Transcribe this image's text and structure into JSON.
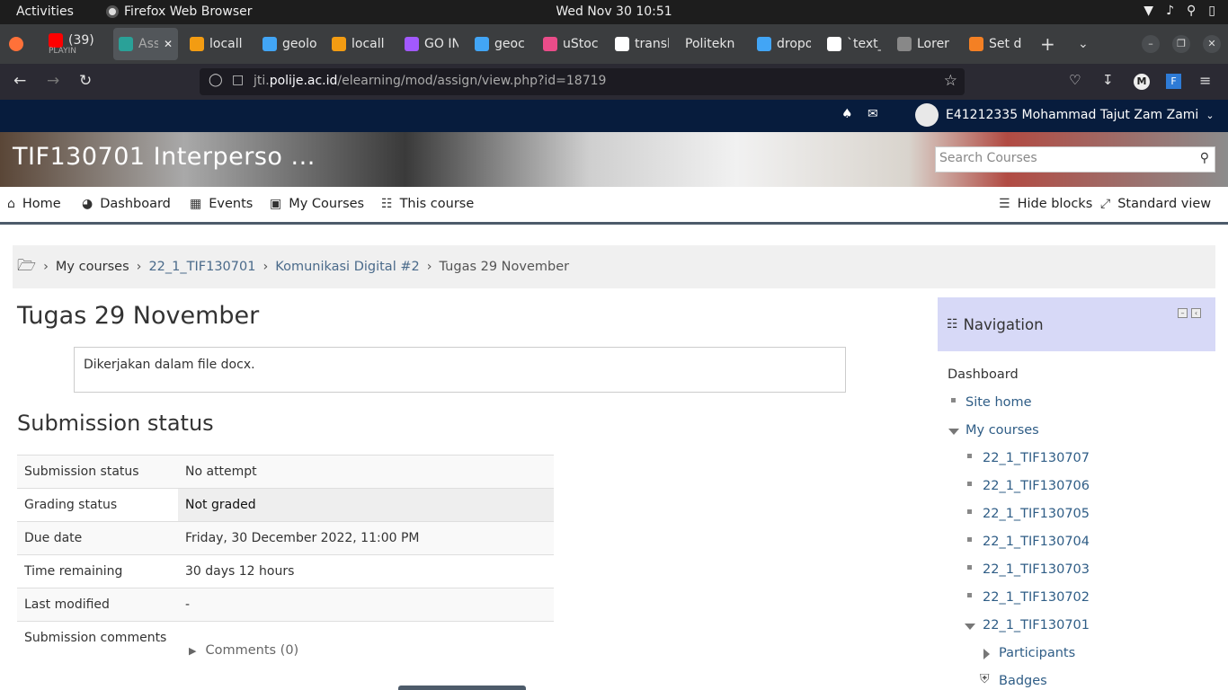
{
  "system": {
    "activities": "Activities",
    "app_name": "Firefox Web Browser",
    "clock": "Wed Nov 30  10:51"
  },
  "tabs": [
    {
      "title": "(39)",
      "subtitle": "PLAYIN",
      "icon": "youtube-icon",
      "color": "#ff0000"
    },
    {
      "title": "Ass",
      "icon": "moodle-icon",
      "color": "#2aa198",
      "active": true
    },
    {
      "title": "locall",
      "icon": "xampp-icon",
      "color": "#f39c12"
    },
    {
      "title": "geolo",
      "icon": "flutter-icon",
      "color": "#42a5f5"
    },
    {
      "title": "locall",
      "icon": "xampp-icon",
      "color": "#f39c12"
    },
    {
      "title": "GO IN",
      "icon": "figma-icon",
      "color": "#a259ff"
    },
    {
      "title": "geoc",
      "icon": "flutter-icon",
      "color": "#42a5f5"
    },
    {
      "title": "uStoc",
      "icon": "dribbble-icon",
      "color": "#ea4c89"
    },
    {
      "title": "transl",
      "icon": "google-icon",
      "color": "#ffffff"
    },
    {
      "title": "Politekn",
      "icon": "",
      "color": "#3b3d3f"
    },
    {
      "title": "dropo",
      "icon": "flutter-icon",
      "color": "#42a5f5"
    },
    {
      "title": "`text_",
      "icon": "github-icon",
      "color": "#ffffff"
    },
    {
      "title": "Lorer",
      "icon": "lorem-icon",
      "color": "#888888"
    },
    {
      "title": "Set d",
      "icon": "stackoverflow-icon",
      "color": "#f48024"
    }
  ],
  "browser": {
    "url_domain": "jti.",
    "url_domain_bold": "polije.ac.id",
    "url_path": "/elearning/mod/assign/view.php?id=18719"
  },
  "moodle": {
    "user_name": "E41212335 Mohammad Tajut Zam Zami",
    "course_title": "TIF130701 Interperso ...",
    "search_placeholder": "Search Courses",
    "menu": {
      "home": "Home",
      "dashboard": "Dashboard",
      "events": "Events",
      "my_courses": "My Courses",
      "this_course": "This course",
      "hide_blocks": "Hide blocks",
      "standard_view": "Standard view"
    },
    "breadcrumb": [
      "My courses",
      "22_1_TIF130701",
      "Komunikasi Digital #2",
      "Tugas 29 November"
    ]
  },
  "assignment": {
    "title": "Tugas 29 November",
    "intro": "Dikerjakan dalam file docx.",
    "status_heading": "Submission status",
    "rows": [
      {
        "label": "Submission status",
        "value": "No attempt"
      },
      {
        "label": "Grading status",
        "value": "Not graded"
      },
      {
        "label": "Due date",
        "value": "Friday, 30 December 2022, 11:00 PM"
      },
      {
        "label": "Time remaining",
        "value": "30 days 12 hours"
      },
      {
        "label": "Last modified",
        "value": "-"
      },
      {
        "label": "Submission comments",
        "value": ""
      }
    ],
    "comments_link": "Comments (0)"
  },
  "navigation": {
    "heading": "Navigation",
    "dashboard": "Dashboard",
    "site_home": "Site home",
    "my_courses": "My courses",
    "courses": [
      "22_1_TIF130707",
      "22_1_TIF130706",
      "22_1_TIF130705",
      "22_1_TIF130704",
      "22_1_TIF130703",
      "22_1_TIF130702",
      "22_1_TIF130701"
    ],
    "participants": "Participants",
    "badges": "Badges"
  }
}
